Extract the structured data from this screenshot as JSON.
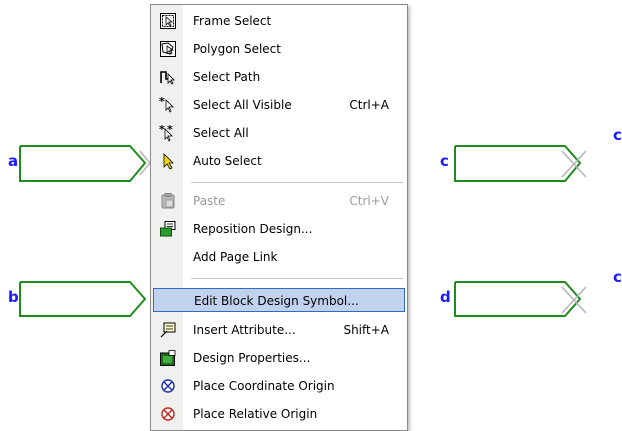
{
  "schematic": {
    "ports": [
      {
        "label": "a"
      },
      {
        "label": "b"
      },
      {
        "label": "c"
      },
      {
        "label": "d"
      }
    ],
    "partial_labels": [
      "c",
      "c"
    ],
    "colors": {
      "block": "#1e8c1e",
      "wire": "#b4b4b4",
      "label": "#1a1aff"
    }
  },
  "context_menu": {
    "items": [
      {
        "label": "Frame Select",
        "shortcut": "",
        "icon": "frame-select-icon",
        "disabled": false
      },
      {
        "label": "Polygon Select",
        "shortcut": "",
        "icon": "polygon-select-icon",
        "disabled": false
      },
      {
        "label": "Select Path",
        "shortcut": "",
        "icon": "select-path-icon",
        "disabled": false
      },
      {
        "label": "Select All Visible",
        "shortcut": "Ctrl+A",
        "icon": "select-all-visible-icon",
        "disabled": false
      },
      {
        "label": "Select All",
        "shortcut": "",
        "icon": "select-all-icon",
        "disabled": false
      },
      {
        "label": "Auto Select",
        "shortcut": "",
        "icon": "auto-select-icon",
        "disabled": false
      },
      {
        "label": "Paste",
        "shortcut": "Ctrl+V",
        "icon": "paste-icon",
        "disabled": true
      },
      {
        "label": "Reposition Design...",
        "shortcut": "",
        "icon": "reposition-icon",
        "disabled": false
      },
      {
        "label": "Add Page Link",
        "shortcut": "",
        "icon": "",
        "disabled": false
      },
      {
        "label": "Edit Block Design Symbol...",
        "shortcut": "",
        "icon": "",
        "disabled": false,
        "highlighted": true
      },
      {
        "label": "Insert Attribute...",
        "shortcut": "Shift+A",
        "icon": "insert-attribute-icon",
        "disabled": false
      },
      {
        "label": "Design Properties...",
        "shortcut": "",
        "icon": "design-properties-icon",
        "disabled": false
      },
      {
        "label": "Place Coordinate Origin",
        "shortcut": "",
        "icon": "coordinate-origin-icon",
        "disabled": false
      },
      {
        "label": "Place Relative Origin",
        "shortcut": "",
        "icon": "relative-origin-icon",
        "disabled": false
      }
    ],
    "highlight_color": "#c1d2ee"
  }
}
